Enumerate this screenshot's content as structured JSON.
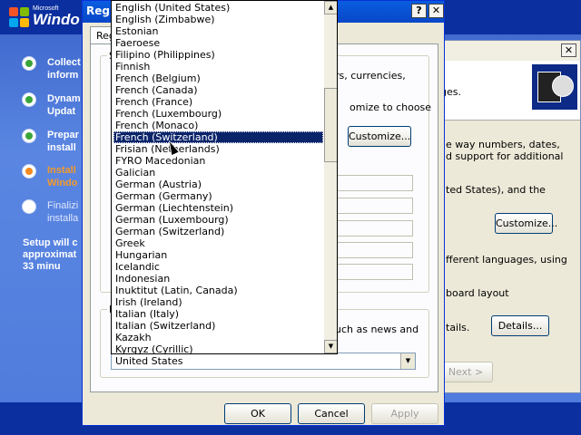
{
  "setup": {
    "brand_small": "Microsoft",
    "brand_name": "Windo",
    "steps": [
      {
        "label": "Collect\ninform",
        "state": "done"
      },
      {
        "label": "Dynam\nUpdat",
        "state": "done"
      },
      {
        "label": "Prepar\ninstall",
        "state": "done"
      },
      {
        "label": "Install\nWindo",
        "state": "current"
      },
      {
        "label": "Finalizi\ninstalla",
        "state": "pending"
      }
    ],
    "remaining": "Setup will c\napproximat\n33 minu"
  },
  "back_window": {
    "close_label": "✕",
    "texts": [
      "ges.",
      "e way numbers, dates,",
      "d support for additional",
      "ted States), and the",
      "fferent languages, using",
      "board layout",
      "tails."
    ],
    "customize_label": "Customize...",
    "details_label": "Details...",
    "next_label": "Next >"
  },
  "dialog": {
    "title": "Regio",
    "help_label": "?",
    "close_label": "✕",
    "tab_label": "Reg",
    "group1_legend": "S",
    "group2_legend": "L",
    "text_currencies": "rs, currencies,",
    "text_customize_choose": "omize to choose",
    "text_news": "uch as news and",
    "customize_label": "Customize...",
    "ok_label": "OK",
    "cancel_label": "Cancel",
    "apply_label": "Apply"
  },
  "dropdown": {
    "items": [
      "English (United States)",
      "English (Zimbabwe)",
      "Estonian",
      "Faeroese",
      "Filipino (Philippines)",
      "Finnish",
      "French (Belgium)",
      "French (Canada)",
      "French (France)",
      "French (Luxembourg)",
      "French (Monaco)",
      "French (Switzerland)",
      "Frisian (Netherlands)",
      "FYRO Macedonian",
      "Galician",
      "German (Austria)",
      "German (Germany)",
      "German (Liechtenstein)",
      "German (Luxembourg)",
      "German (Switzerland)",
      "Greek",
      "Hungarian",
      "Icelandic",
      "Indonesian",
      "Inuktitut (Latin, Canada)",
      "Irish (Ireland)",
      "Italian (Italy)",
      "Italian (Switzerland)",
      "Kazakh",
      "Kyrgyz (Cyrillic)"
    ],
    "selected_index": 11,
    "combo_value": "United States",
    "scroll_up": "▲",
    "scroll_down": "▼",
    "combo_arrow": "▼"
  }
}
